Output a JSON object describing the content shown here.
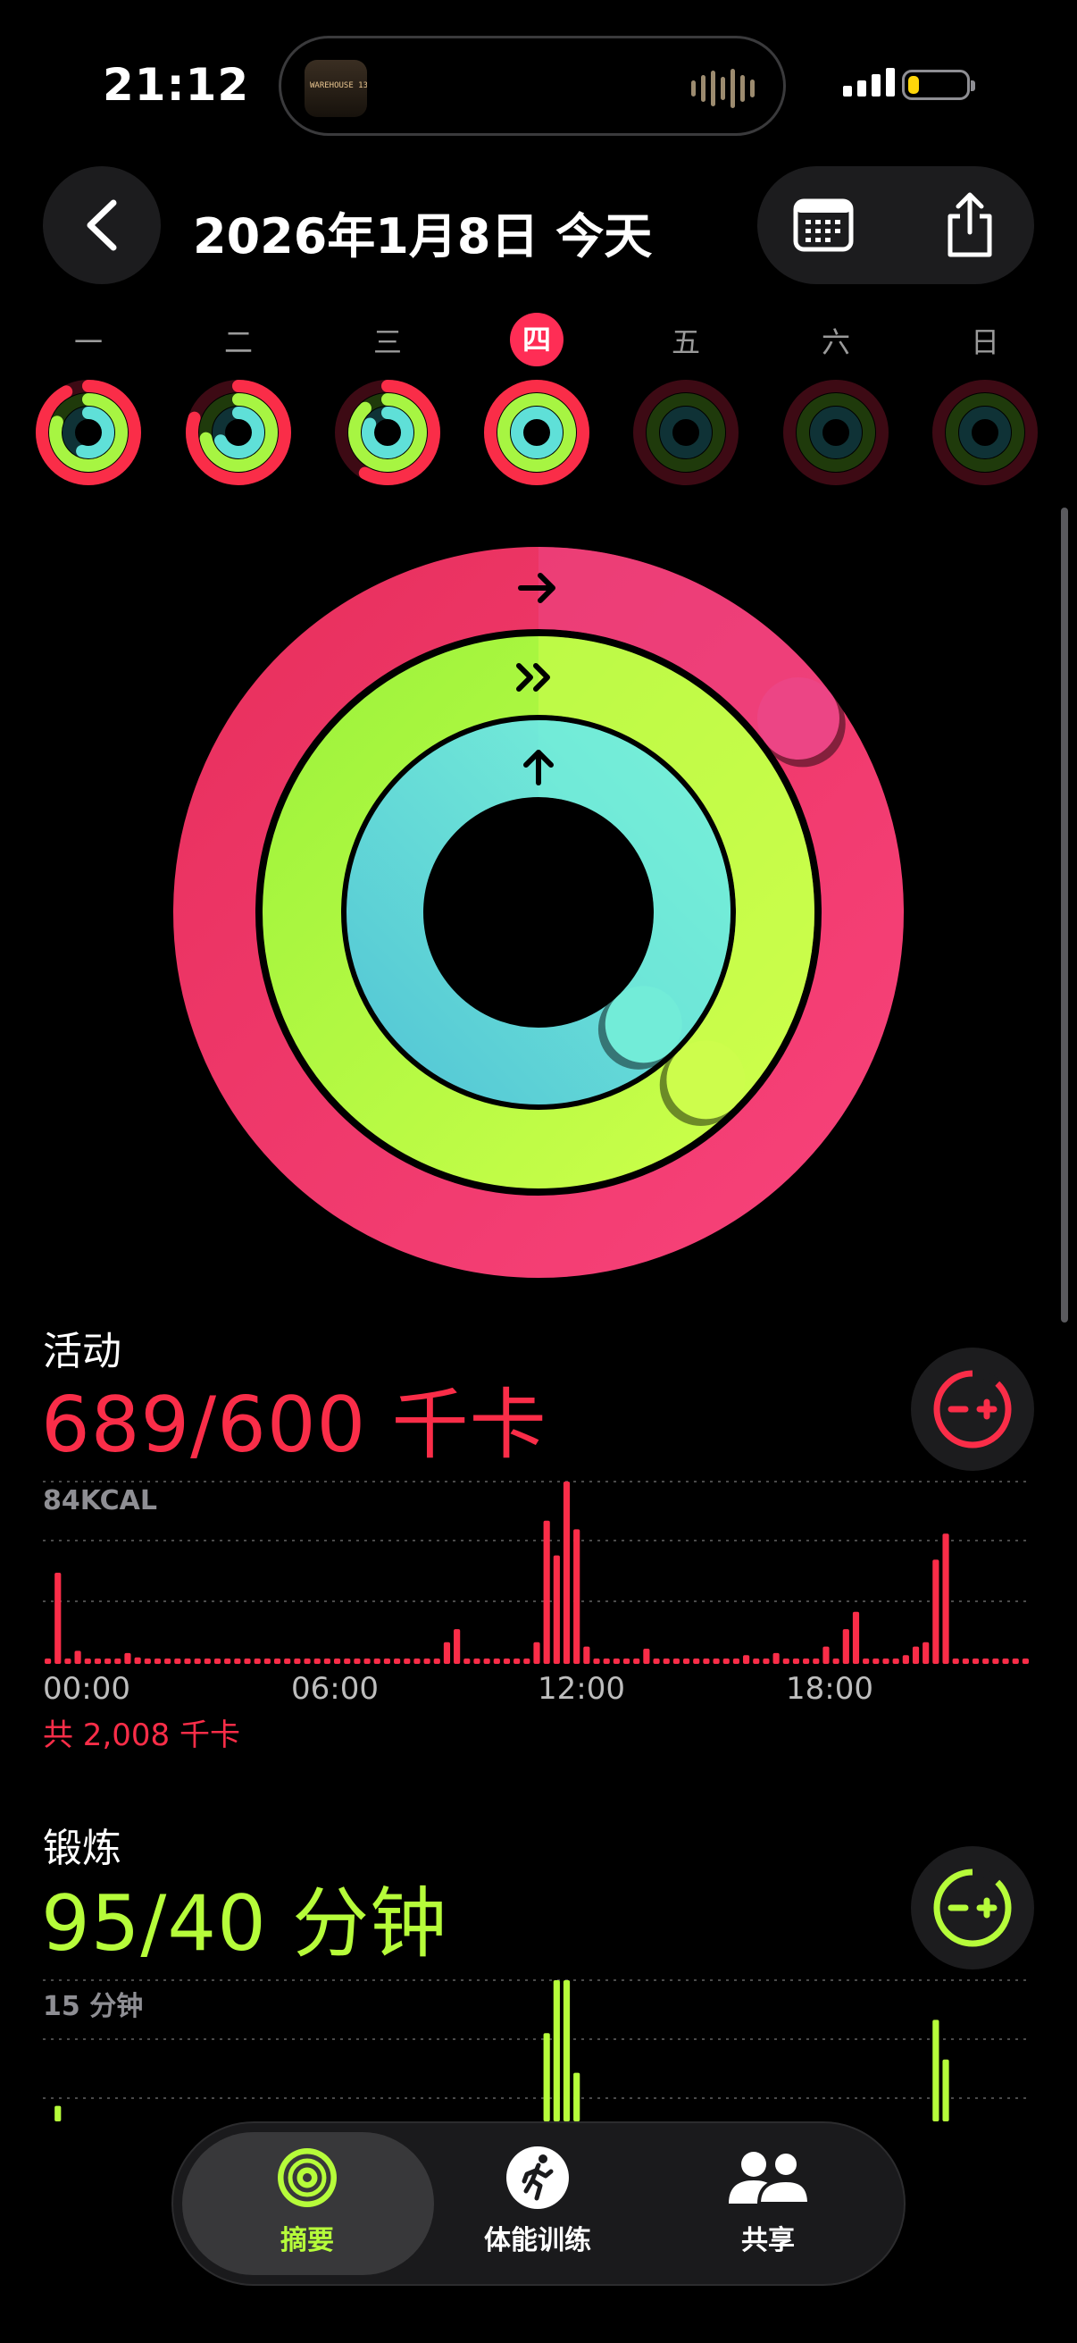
{
  "status": {
    "time": "21:12",
    "island_caption": "WAREHOUSE 13"
  },
  "header": {
    "date_title": "2026年1月8日 今天"
  },
  "week": {
    "days": [
      {
        "label": "一",
        "move": 0.92,
        "exercise": 0.8,
        "stand": 0.55,
        "today": false,
        "active": true
      },
      {
        "label": "二",
        "move": 0.8,
        "exercise": 0.72,
        "stand": 0.68,
        "today": false,
        "active": true
      },
      {
        "label": "三",
        "move": 0.58,
        "exercise": 0.88,
        "stand": 0.82,
        "today": false,
        "active": true
      },
      {
        "label": "四",
        "move": 1.0,
        "exercise": 1.0,
        "stand": 1.0,
        "today": true,
        "active": true
      },
      {
        "label": "五",
        "move": 0,
        "exercise": 0,
        "stand": 0,
        "today": false,
        "active": false
      },
      {
        "label": "六",
        "move": 0,
        "exercise": 0,
        "stand": 0,
        "today": false,
        "active": false
      },
      {
        "label": "日",
        "move": 0,
        "exercise": 0,
        "stand": 0,
        "today": false,
        "active": false
      }
    ]
  },
  "rings": {
    "move_progress": 1.148,
    "exercise_progress": 2.375,
    "stand_progress": 1.38
  },
  "activity": {
    "label": "活动",
    "value": "689/600 千卡",
    "axis_max": "84KCAL",
    "hours": [
      "00:00",
      "06:00",
      "12:00",
      "18:00"
    ],
    "total": "共 2,008 千卡",
    "color": "#fa2d48",
    "max_value": 84,
    "bars": [
      2,
      42,
      2,
      6,
      2,
      2,
      2,
      2,
      5,
      3,
      2,
      2,
      2,
      2,
      2,
      2,
      2,
      2,
      2,
      2,
      2,
      2,
      2,
      2,
      2,
      2,
      2,
      2,
      2,
      2,
      2,
      2,
      2,
      2,
      2,
      2,
      2,
      2,
      2,
      2,
      10,
      16,
      2,
      2,
      2,
      2,
      2,
      2,
      2,
      10,
      66,
      50,
      84,
      62,
      8,
      2,
      2,
      2,
      2,
      2,
      7,
      2,
      2,
      2,
      2,
      2,
      2,
      2,
      2,
      2,
      4,
      2,
      2,
      5,
      2,
      2,
      2,
      2,
      8,
      2,
      16,
      24,
      2,
      2,
      2,
      2,
      4,
      8,
      10,
      48,
      60,
      2,
      2,
      2,
      2,
      2,
      2,
      2,
      2
    ]
  },
  "exercise": {
    "label": "锻炼",
    "value": "95/40 分钟",
    "axis_max": "15 分钟",
    "color": "#b6fc3a",
    "max_value": 15,
    "bars": [
      0,
      5.5,
      0,
      0,
      0,
      0,
      0,
      0,
      0,
      0,
      0,
      0,
      0,
      0,
      0,
      0,
      0,
      0,
      0,
      0,
      0,
      0,
      0,
      0,
      0,
      0,
      0,
      0,
      0,
      0,
      0,
      0,
      0,
      0,
      0,
      0,
      0,
      0,
      0,
      0,
      0,
      0,
      0,
      0,
      0,
      0,
      0,
      0,
      0,
      0,
      11,
      15,
      15,
      8,
      0,
      0,
      0,
      0,
      0,
      0,
      0,
      0,
      0,
      0,
      0,
      0,
      0,
      0,
      0,
      0,
      0,
      0,
      0,
      0,
      0,
      0,
      0,
      0,
      0,
      0,
      0,
      0,
      1.8,
      0,
      0,
      0,
      0,
      0,
      0,
      12,
      9,
      0,
      0,
      0,
      0,
      0,
      0,
      0,
      0
    ]
  },
  "tabs": [
    {
      "label": "摘要",
      "active": true
    },
    {
      "label": "体能训练",
      "active": false
    },
    {
      "label": "共享",
      "active": false
    }
  ]
}
